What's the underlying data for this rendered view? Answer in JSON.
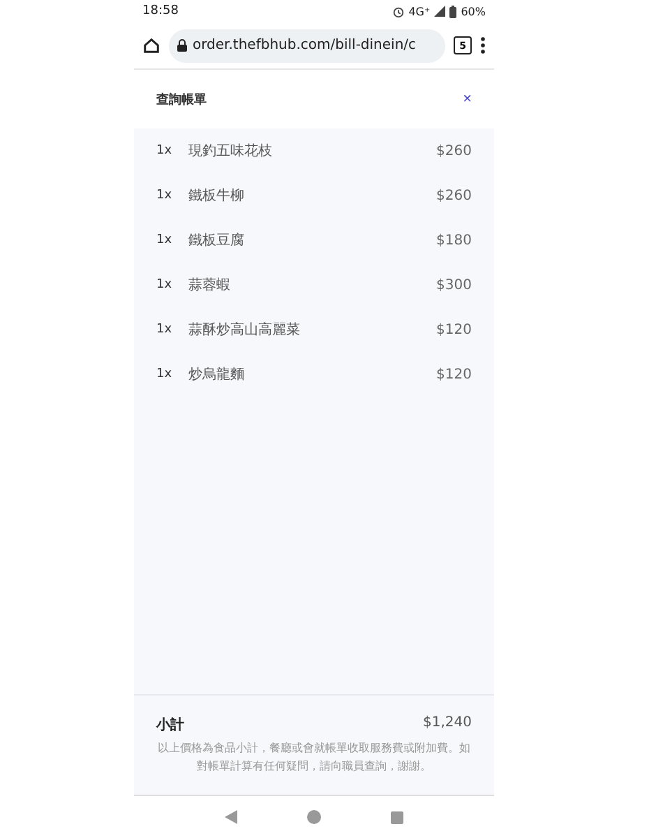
{
  "status_bar": {
    "time": "18:58",
    "network": "4G⁺",
    "battery": "60%"
  },
  "browser": {
    "url": "order.thefbhub.com/bill-dinein/c",
    "tab_count": "5"
  },
  "dialog": {
    "title": "查詢帳單",
    "close": "×"
  },
  "items": [
    {
      "qty": "1x",
      "name": "現釣五味花枝",
      "price": "$260"
    },
    {
      "qty": "1x",
      "name": "鐵板牛柳",
      "price": "$260"
    },
    {
      "qty": "1x",
      "name": "鐵板豆腐",
      "price": "$180"
    },
    {
      "qty": "1x",
      "name": "蒜蓉蝦",
      "price": "$300"
    },
    {
      "qty": "1x",
      "name": "蒜酥炒高山高麗菜",
      "price": "$120"
    },
    {
      "qty": "1x",
      "name": "炒烏龍麵",
      "price": "$120"
    }
  ],
  "subtotal": {
    "label": "小計",
    "amount": "$1,240",
    "note": "以上價格為食品小計，餐廳或會就帳單收取服務費或附加費。如對帳單計算有任何疑問，請向職員查詢，謝謝。"
  }
}
